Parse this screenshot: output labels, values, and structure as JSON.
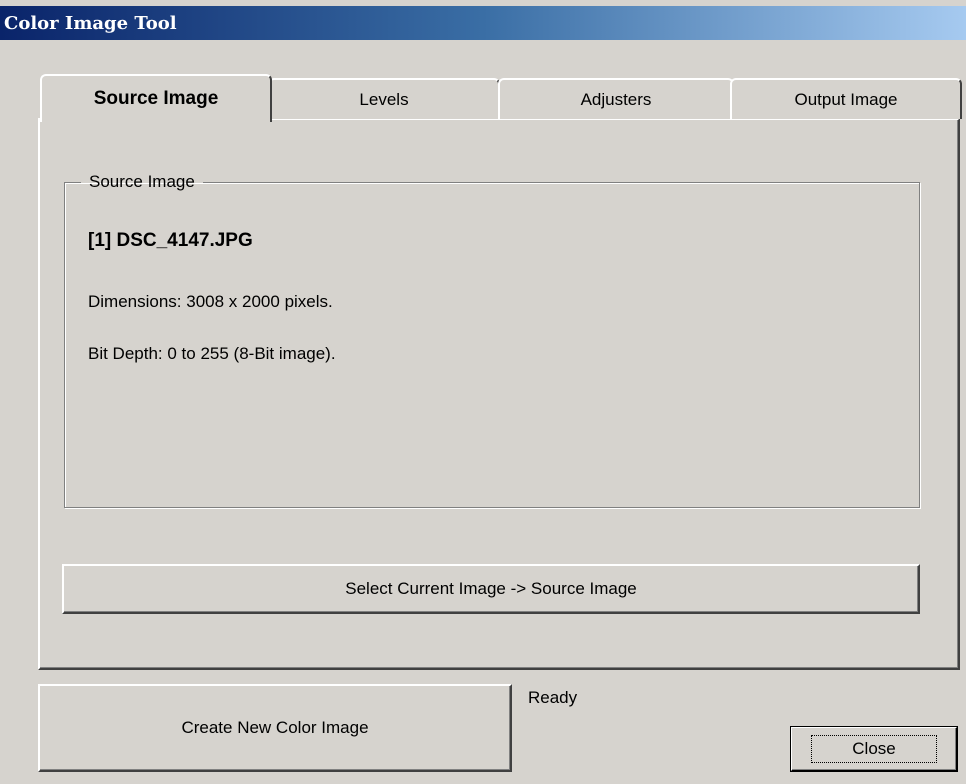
{
  "window": {
    "title": "Color Image Tool"
  },
  "tabs": [
    {
      "label": "Source Image",
      "active": true
    },
    {
      "label": "Levels",
      "active": false
    },
    {
      "label": "Adjusters",
      "active": false
    },
    {
      "label": "Output Image",
      "active": false
    }
  ],
  "source_group": {
    "legend": "Source Image",
    "filename": "[1] DSC_4147.JPG",
    "dimensions": "Dimensions:  3008 x  2000 pixels.",
    "bit_depth": "Bit Depth: 0 to 255 (8-Bit image)."
  },
  "buttons": {
    "select_current": "Select Current Image -> Source Image",
    "create_new": "Create New Color Image",
    "close": "Close"
  },
  "status": "Ready",
  "colors": {
    "face": "#d6d3ce",
    "title_start": "#0a246a",
    "title_end": "#a6caf0"
  }
}
